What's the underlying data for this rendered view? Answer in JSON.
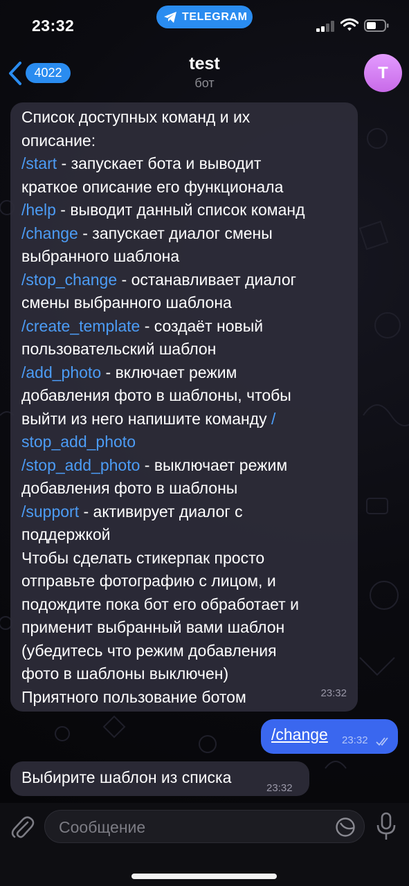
{
  "status_bar": {
    "time": "23:32",
    "return_app": "TELEGRAM"
  },
  "header": {
    "back_count": "4022",
    "title": "test",
    "subtitle": "бот",
    "avatar_letter": "T"
  },
  "messages": {
    "commands_list": {
      "lines": [
        [
          {
            "t": "Список доступных команд и их",
            "cmd": false
          }
        ],
        [
          {
            "t": "описание:",
            "cmd": false
          }
        ],
        [
          {
            "t": "/start",
            "cmd": true
          },
          {
            "t": " - запускает бота и выводит",
            "cmd": false
          }
        ],
        [
          {
            "t": "краткое описание его функционала",
            "cmd": false
          }
        ],
        [
          {
            "t": "/help",
            "cmd": true
          },
          {
            "t": " - выводит данный список команд",
            "cmd": false
          }
        ],
        [
          {
            "t": "/change",
            "cmd": true
          },
          {
            "t": " - запускает диалог смены",
            "cmd": false
          }
        ],
        [
          {
            "t": "выбранного шаблона",
            "cmd": false
          }
        ],
        [
          {
            "t": "/stop_change",
            "cmd": true
          },
          {
            "t": " - останавливает диалог",
            "cmd": false
          }
        ],
        [
          {
            "t": "смены выбранного шаблона",
            "cmd": false
          }
        ],
        [
          {
            "t": "/create_template",
            "cmd": true
          },
          {
            "t": " - создаёт новый",
            "cmd": false
          }
        ],
        [
          {
            "t": "пользовательский шаблон",
            "cmd": false
          }
        ],
        [
          {
            "t": "/add_photo",
            "cmd": true
          },
          {
            "t": " - включает режим",
            "cmd": false
          }
        ],
        [
          {
            "t": "добавления фото в шаблоны, чтобы",
            "cmd": false
          }
        ],
        [
          {
            "t": "выйти из него напишите команду ",
            "cmd": false
          },
          {
            "t": "/",
            "cmd": true
          }
        ],
        [
          {
            "t": "stop_add_photo",
            "cmd": true
          }
        ],
        [
          {
            "t": "/stop_add_photo",
            "cmd": true
          },
          {
            "t": " - выключает режим",
            "cmd": false
          }
        ],
        [
          {
            "t": "добавления фото в шаблоны",
            "cmd": false
          }
        ],
        [
          {
            "t": "/support",
            "cmd": true
          },
          {
            "t": " - активирует диалог с",
            "cmd": false
          }
        ],
        [
          {
            "t": "поддержкой",
            "cmd": false
          }
        ],
        [
          {
            "t": "Чтобы сделать стикерпак просто",
            "cmd": false
          }
        ],
        [
          {
            "t": "отправьте фотографию с лицом, и",
            "cmd": false
          }
        ],
        [
          {
            "t": "подождите пока бот его обработает и",
            "cmd": false
          }
        ],
        [
          {
            "t": "применит выбранный вами шаблон",
            "cmd": false
          }
        ],
        [
          {
            "t": "(убедитесь что режим добавления",
            "cmd": false
          }
        ],
        [
          {
            "t": "фото в шаблоны выключен)",
            "cmd": false
          }
        ],
        [
          {
            "t": "Приятного пользование ботом",
            "cmd": false
          }
        ]
      ],
      "time": "23:32"
    },
    "outgoing": {
      "text": "/change",
      "time": "23:32"
    },
    "reply": {
      "text": "Выбирите шаблон из списка",
      "time": "23:32"
    }
  },
  "input": {
    "placeholder": "Сообщение"
  },
  "colors": {
    "accent": "#2a8cf0",
    "outgoing_bubble": "#3a67ef",
    "incoming_bubble": "#2e2c3a",
    "command_link": "#4c9cf5"
  }
}
